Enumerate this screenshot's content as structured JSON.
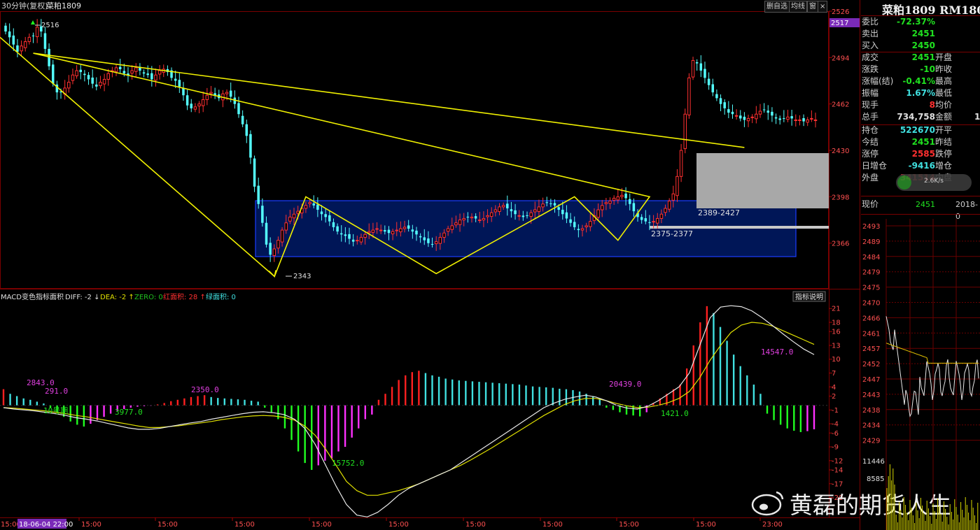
{
  "window": {
    "period": "30分钟(复权)",
    "symbol": "菜粕1809",
    "buttons": [
      "删自选",
      "均线",
      "窗",
      "×"
    ]
  },
  "chart_data": [
    {
      "type": "candlestick",
      "title": "",
      "ylim": [
        2335,
        2526
      ],
      "y_ticks": [
        2526,
        2494,
        2462,
        2430,
        2398,
        2366
      ],
      "current_price_tag": "2517",
      "x_tick_labels": [
        "15:00",
        "15:00",
        "15:00",
        "15:00",
        "15:00",
        "15:00",
        "15:00",
        "15:00",
        "15:00",
        "15:00",
        "23:00"
      ],
      "x_cursor_label": "18-06-04 22:00",
      "x_first_label": "15:00",
      "closes": [
        2512,
        2508,
        2503,
        2498,
        2502,
        2505,
        2508,
        2509,
        2515,
        2512,
        2500,
        2488,
        2476,
        2470,
        2470,
        2473,
        2477,
        2482,
        2485,
        2484,
        2482,
        2479,
        2476,
        2474,
        2477,
        2479,
        2483,
        2485,
        2487,
        2486,
        2483,
        2482,
        2485,
        2487,
        2485,
        2483,
        2482,
        2479,
        2482,
        2485,
        2486,
        2484,
        2480,
        2478,
        2474,
        2468,
        2461,
        2459,
        2460,
        2462,
        2465,
        2468,
        2470,
        2468,
        2466,
        2469,
        2470,
        2467,
        2462,
        2455,
        2448,
        2440,
        2425,
        2405,
        2393,
        2380,
        2365,
        2358,
        2362,
        2368,
        2375,
        2380,
        2384,
        2386,
        2388,
        2390,
        2392,
        2394,
        2392,
        2389,
        2386,
        2384,
        2381,
        2377,
        2374,
        2372,
        2371,
        2369,
        2367,
        2368,
        2370,
        2372,
        2374,
        2375,
        2376,
        2375,
        2374,
        2373,
        2374,
        2375,
        2376,
        2377,
        2376,
        2374,
        2372,
        2370,
        2368,
        2366,
        2365,
        2367,
        2370,
        2373,
        2376,
        2378,
        2380,
        2382,
        2383,
        2384,
        2384,
        2383,
        2382,
        2383,
        2385,
        2387,
        2389,
        2391,
        2392,
        2390,
        2388,
        2386,
        2385,
        2384,
        2385,
        2387,
        2389,
        2391,
        2393,
        2394,
        2393,
        2392,
        2389,
        2386,
        2383,
        2380,
        2377,
        2375,
        2376,
        2378,
        2381,
        2385,
        2389,
        2392,
        2394,
        2395,
        2397,
        2398,
        2399,
        2397,
        2393,
        2388,
        2384,
        2382,
        2381,
        2380,
        2381,
        2383,
        2386,
        2390,
        2395,
        2400,
        2412,
        2430,
        2455,
        2480,
        2492,
        2490,
        2485,
        2480,
        2475,
        2470,
        2466,
        2462,
        2459,
        2456,
        2455,
        2454,
        2452,
        2451,
        2452,
        2453,
        2455,
        2457,
        2458,
        2456,
        2454,
        2452,
        2451,
        2452,
        2453,
        2452,
        2451,
        2451,
        2450,
        2451,
        2452,
        2451
      ],
      "annotations": [
        {
          "label": "2516",
          "price": 2516
        },
        {
          "label": "2343",
          "price": 2343
        },
        {
          "label": "2389-2427"
        },
        {
          "label": "2375-2377"
        }
      ]
    },
    {
      "type": "bar",
      "title": "MACD变色指标面积",
      "legend": [
        {
          "name": "DIFF:",
          "value": "-2",
          "arrow": "↓",
          "color": "#e0e0e0"
        },
        {
          "name": "DEA:",
          "value": "-2",
          "arrow": "↑",
          "color": "#e0e000"
        },
        {
          "name": "ZERO:",
          "value": "0",
          "arrow": "",
          "color": "#20c020"
        },
        {
          "name": "红面积:",
          "value": "28",
          "arrow": "↑",
          "color": "#ff3030"
        },
        {
          "name": "绿面积:",
          "value": "0",
          "arrow": "",
          "color": "#40e0e0"
        }
      ],
      "ylim": [
        -24,
        23
      ],
      "y_ticks": [
        21,
        18,
        16,
        13,
        10,
        7,
        4,
        2,
        -1,
        -4,
        -6,
        -9,
        -12,
        -14,
        -17,
        -20
      ],
      "help_button": "指标说明",
      "area_labels": [
        {
          "text": "2843.0",
          "color": "#e040e0"
        },
        {
          "text": "291.0",
          "color": "#e040e0"
        },
        {
          "text": "3977.0",
          "color": "#20e020"
        },
        {
          "text": "2350.0",
          "color": "#e040e0"
        },
        {
          "text": "15752.0",
          "color": "#20e020"
        },
        {
          "text": "20439.0",
          "color": "#e040e0"
        },
        {
          "text": "1421.0",
          "color": "#20e020"
        },
        {
          "text": "14547.0",
          "color": "#e040e0"
        },
        {
          "text": "10号期",
          "color": "#20e020"
        }
      ],
      "histogram": [
        3.5,
        2.5,
        2,
        1.5,
        1.2,
        0.8,
        0.4,
        -0.5,
        -1.5,
        -2.5,
        -3.5,
        -4.2,
        -4.6,
        -4,
        -3.2,
        -2.5,
        -1.8,
        -1.2,
        -0.8,
        -0.5,
        -0.3,
        -0.2,
        -0.1,
        0.2,
        0.5,
        0.9,
        1.2,
        1.5,
        1.8,
        2,
        2.2,
        1.8,
        1.6,
        1.5,
        1.4,
        1.3,
        1.2,
        1,
        0.8,
        -0.5,
        -1.5,
        -3,
        -5,
        -7.5,
        -10,
        -12.5,
        -14,
        -13,
        -12,
        -11.5,
        -10,
        -9,
        -7,
        -5,
        -3,
        -2,
        1.2,
        2.5,
        4,
        5.5,
        6.5,
        7.2,
        7.5,
        7,
        6.5,
        6.2,
        5.8,
        5.6,
        5.4,
        5.3,
        5.2,
        5.1,
        5,
        4.9,
        4.8,
        4.7,
        4.6,
        4.5,
        4.3,
        4.1,
        4,
        3.9,
        3.8,
        3.6,
        3.5,
        3.3,
        3,
        2.5,
        2,
        1.5,
        -0.5,
        -1,
        -1.5,
        -2,
        -2.2,
        -2.4,
        -1.5,
        0.5,
        1.5,
        2.5,
        3.5,
        4.5,
        8,
        13,
        18,
        21.5,
        20,
        17,
        14,
        11,
        8.5,
        6.5,
        4.5,
        2.5,
        -1.8,
        -3.2,
        -4.2,
        -5,
        -5.5,
        -5.8,
        -5.6,
        -5.2
      ],
      "diff": [
        -0.5,
        -0.8,
        -1,
        -1.2,
        -1.5,
        -1.8,
        -2.2,
        -2.7,
        -3,
        -3.4,
        -3.9,
        -4.4,
        -4.9,
        -5.2,
        -5.2,
        -5,
        -4.6,
        -4.2,
        -3.8,
        -3.5,
        -3,
        -2.6,
        -2.2,
        -1.8,
        -1.5,
        -1.4,
        -1.6,
        -2,
        -3,
        -5,
        -8.5,
        -13,
        -17.5,
        -21.5,
        -23.8,
        -24.2,
        -23.2,
        -21.5,
        -19.5,
        -18,
        -17,
        -16,
        -15,
        -14,
        -12.5,
        -11,
        -9.5,
        -8,
        -6.5,
        -5,
        -3.5,
        -2,
        -0.5,
        0.5,
        1.3,
        1.8,
        2.2,
        1.8,
        1,
        0,
        -0.6,
        -0.8,
        -0.2,
        1,
        2.5,
        4,
        7,
        13,
        19,
        21.3,
        21.6,
        21.4,
        20.5,
        19,
        17.3,
        15.5,
        13.8,
        12.2,
        11
      ],
      "dea": [
        -0.5,
        -0.6,
        -0.8,
        -1,
        -1.2,
        -1.5,
        -1.8,
        -2.2,
        -2.5,
        -2.9,
        -3.3,
        -3.7,
        -4.1,
        -4.5,
        -4.8,
        -4.8,
        -4.6,
        -4.4,
        -4.1,
        -3.8,
        -3.5,
        -3.1,
        -2.8,
        -2.5,
        -2.3,
        -2.2,
        -2.3,
        -2.6,
        -3.2,
        -4.5,
        -6.5,
        -9.5,
        -13,
        -16.5,
        -18.5,
        -19.5,
        -19.5,
        -19,
        -18.5,
        -17.8,
        -17,
        -16,
        -15,
        -14,
        -13,
        -11.8,
        -10.5,
        -9.2,
        -7.8,
        -6.4,
        -5,
        -3.6,
        -2.2,
        -1,
        0.2,
        1,
        1.5,
        1.5,
        1,
        0.4,
        -0.1,
        -0.5,
        -0.4,
        0,
        0.6,
        1.5,
        3,
        6,
        9.8,
        13,
        15.8,
        17.4,
        18,
        17.8,
        17.2,
        16.2,
        15.2,
        14.2,
        13.2
      ]
    }
  ],
  "quote": {
    "title": "菜粕1809 RM1809",
    "rows": [
      {
        "label": "委比",
        "value": "-72.37%",
        "color": "#20e020"
      },
      {
        "label": "卖出",
        "value": "2451",
        "color": "#20e020"
      },
      {
        "label": "买入",
        "value": "2450",
        "color": "#20e020"
      }
    ],
    "rows2": [
      {
        "label": "成交",
        "value": "2451",
        "color": "#20e020",
        "label2": "开盘"
      },
      {
        "label": "涨跌",
        "value": "-10",
        "color": "#20e020",
        "label2": "昨收"
      },
      {
        "label": "涨幅(结)",
        "value": "-0.41%",
        "color": "#20e020",
        "label2": "最高"
      },
      {
        "label": "振幅",
        "value": "1.67%",
        "color": "#40e0e0",
        "label2": "最低"
      },
      {
        "label": "现手",
        "value": "8",
        "color": "#ff3030",
        "label2": "均价"
      },
      {
        "label": "总手",
        "value": "734,758",
        "color": "#e0e0e0",
        "label2": "金额",
        "value2": "1"
      }
    ],
    "rows3": [
      {
        "label": "持仓",
        "value": "522670",
        "color": "#40e0e0",
        "label2": "开平"
      },
      {
        "label": "今结",
        "value": "2451",
        "color": "#20e020",
        "label2": "昨结"
      },
      {
        "label": "涨停",
        "value": "2585",
        "color": "#ff3030",
        "label2": "跌停"
      },
      {
        "label": "日增仓",
        "value": "-9416",
        "color": "#40e0e0",
        "label2": "增仓"
      },
      {
        "label": "外盘",
        "value": "341514",
        "color": "#ff3030",
        "label2": "内盘"
      }
    ],
    "speed_badge": "2.6K/s",
    "current": {
      "label": "现价",
      "value": "2451",
      "date": "2018-0"
    }
  },
  "mini_chart": {
    "y_ticks": [
      "2493",
      "2489",
      "2484",
      "2479",
      "2475",
      "2470",
      "2466",
      "2461",
      "2457",
      "2452",
      "2447",
      "2443",
      "2438",
      "2434",
      "2429"
    ],
    "vol_ticks": [
      "11446",
      "8585"
    ]
  },
  "watermark": "黄磊的期货人生"
}
